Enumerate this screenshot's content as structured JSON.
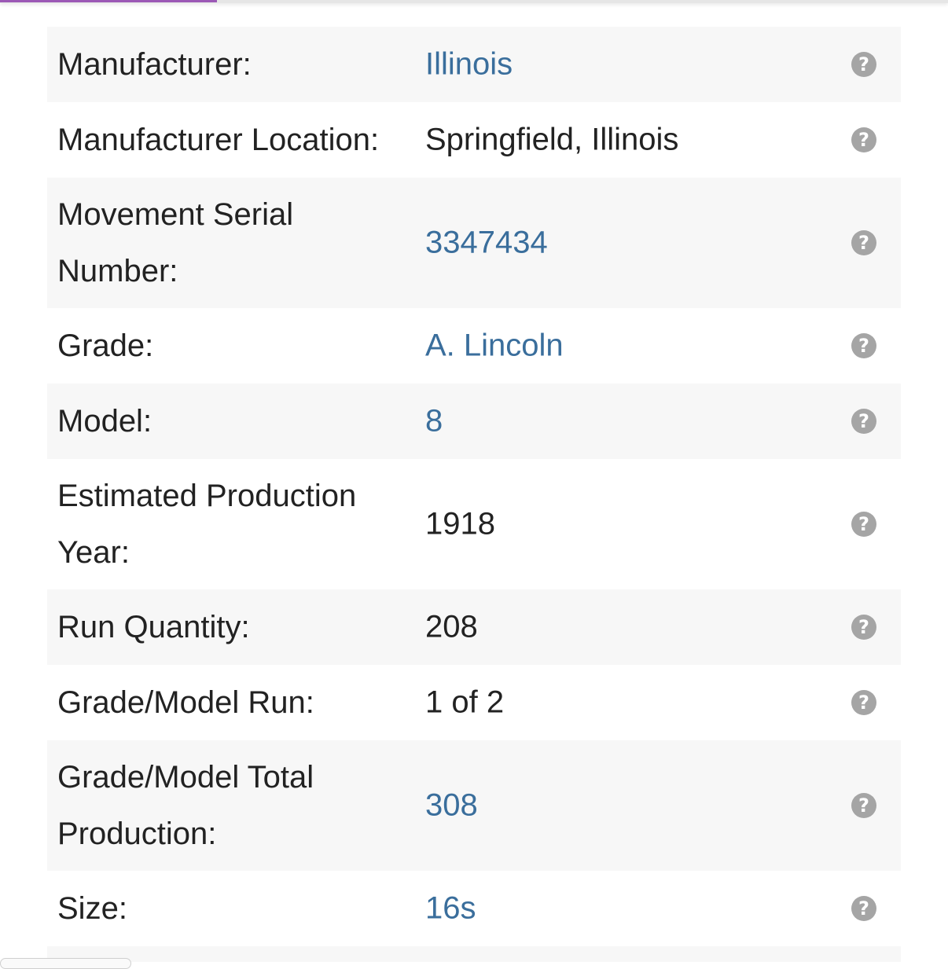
{
  "specs": [
    {
      "label": "Manufacturer:",
      "value": "Illinois",
      "link": true,
      "help": "?"
    },
    {
      "label": "Manufacturer Location:",
      "value": "Springfield, Illinois",
      "link": false,
      "help": "?"
    },
    {
      "label": "Movement Serial Number:",
      "value": "3347434",
      "link": true,
      "help": "?"
    },
    {
      "label": "Grade:",
      "value": "A. Lincoln",
      "link": true,
      "help": "?"
    },
    {
      "label": "Model:",
      "value": "8",
      "link": true,
      "help": "?"
    },
    {
      "label": "Estimated Production Year:",
      "value": "1918",
      "link": false,
      "help": "?"
    },
    {
      "label": "Run Quantity:",
      "value": "208",
      "link": false,
      "help": "?"
    },
    {
      "label": "Grade/Model Run:",
      "value": "1 of 2",
      "link": false,
      "help": "?"
    },
    {
      "label": "Grade/Model Total Production:",
      "value": "308",
      "link": true,
      "help": "?"
    },
    {
      "label": "Size:",
      "value": "16s",
      "link": true,
      "help": "?"
    }
  ],
  "colors": {
    "link": "#3a6e9c",
    "text": "#222222",
    "row_alt": "#f7f7f7",
    "help_icon": "#a5a5a5",
    "progress": "#9c59b6"
  },
  "icons": {
    "help": "question-circle-icon"
  }
}
